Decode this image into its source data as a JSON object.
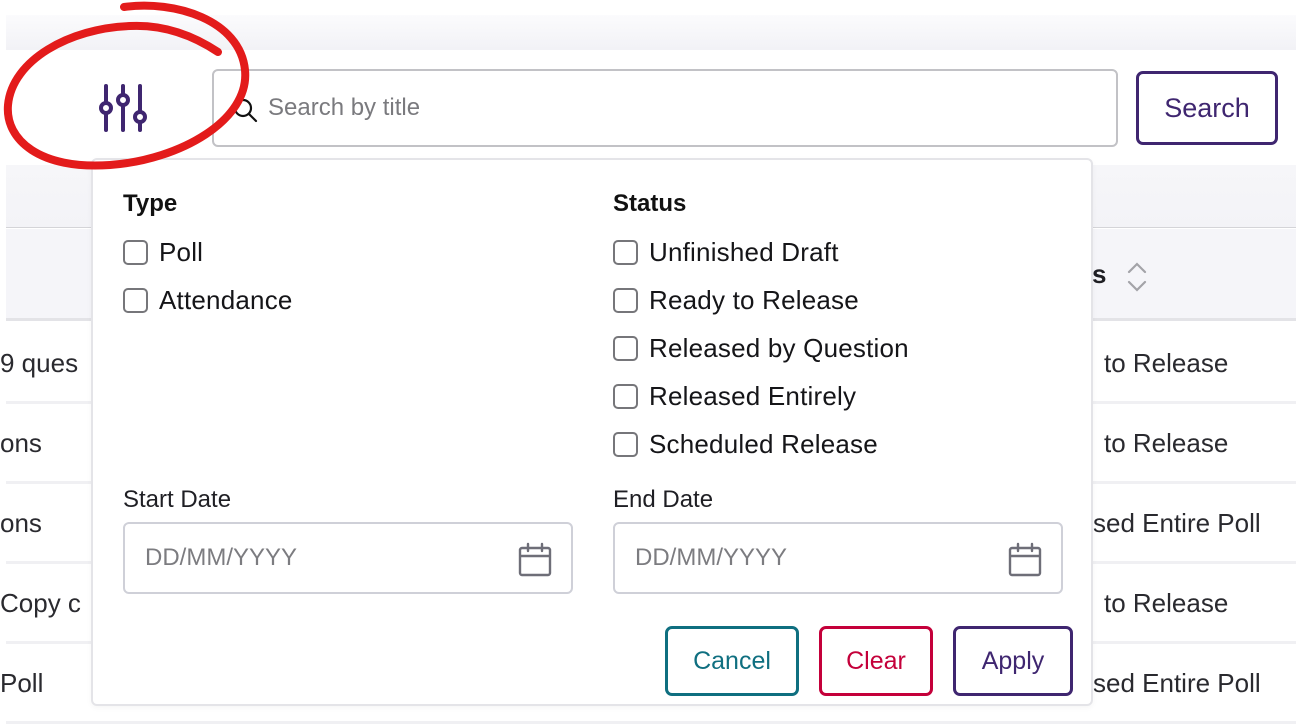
{
  "toolbar": {
    "filter_button_icon": "sliders-icon",
    "search_placeholder": "Search by title",
    "search_value": "",
    "search_icon": "search-icon",
    "search_button_label": "Search",
    "accent_color": "#3f2670"
  },
  "table": {
    "status_header": "s",
    "sort_icon": "sort-chevrons-icon",
    "rows": [
      {
        "title_fragment": "9 ques",
        "status_fragment": "to Release"
      },
      {
        "title_fragment": "ons",
        "status_fragment": "to Release"
      },
      {
        "title_fragment": "ons",
        "status_fragment": "sed Entire Poll"
      },
      {
        "title_fragment": "Copy c",
        "status_fragment": "to Release"
      },
      {
        "title_fragment": "Poll",
        "status_fragment": "sed Entire Poll"
      }
    ]
  },
  "filter_panel": {
    "type_group": {
      "title": "Type",
      "options": [
        {
          "label": "Poll",
          "checked": false
        },
        {
          "label": "Attendance",
          "checked": false
        }
      ]
    },
    "status_group": {
      "title": "Status",
      "options": [
        {
          "label": "Unfinished Draft",
          "checked": false
        },
        {
          "label": "Ready to Release",
          "checked": false
        },
        {
          "label": "Released by Question",
          "checked": false
        },
        {
          "label": "Released Entirely",
          "checked": false
        },
        {
          "label": "Scheduled Release",
          "checked": false
        }
      ]
    },
    "start_date": {
      "label": "Start Date",
      "placeholder": "DD/MM/YYYY",
      "value": "",
      "icon": "calendar-icon"
    },
    "end_date": {
      "label": "End Date",
      "placeholder": "DD/MM/YYYY",
      "value": "",
      "icon": "calendar-icon"
    },
    "buttons": {
      "cancel": {
        "label": "Cancel",
        "color": "#0f6f80"
      },
      "clear": {
        "label": "Clear",
        "color": "#c4003a"
      },
      "apply": {
        "label": "Apply",
        "color": "#3f2670"
      }
    }
  },
  "annotation": {
    "shape": "red-circle",
    "color": "#e31b1b",
    "target": "filter-toggle-button"
  }
}
